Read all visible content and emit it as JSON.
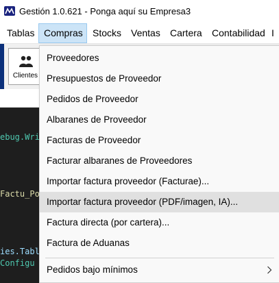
{
  "window": {
    "title": "Gestión 1.0.621 - Ponga aquí su Empresa3"
  },
  "menubar": {
    "items": [
      {
        "label": "Tablas"
      },
      {
        "label": "Compras"
      },
      {
        "label": "Stocks"
      },
      {
        "label": "Ventas"
      },
      {
        "label": "Cartera"
      },
      {
        "label": "Contabilidad"
      },
      {
        "label": "I"
      }
    ]
  },
  "toolbar": {
    "clientes_label": "Clientes"
  },
  "editor": {
    "lines": [
      {
        "text": "ebug.Wri",
        "color": "#4ec9b0"
      },
      {
        "text": "Factu_Po",
        "color": "#dcdcaa"
      },
      {
        "text": "ies.Tabl",
        "color": "#9cdcfe"
      },
      {
        "text": "Configu",
        "color": "#4ec9b0"
      }
    ]
  },
  "compras_menu": {
    "items": [
      {
        "label": "Proveedores"
      },
      {
        "label": "Presupuestos de Proveedor"
      },
      {
        "label": "Pedidos de Proveedor"
      },
      {
        "label": "Albaranes de Proveedor"
      },
      {
        "label": "Facturas de Proveedor"
      },
      {
        "label": "Facturar albaranes de Proveedores"
      },
      {
        "label": "Importar factura proveedor (Facturae)..."
      },
      {
        "label": "Importar factura proveedor (PDF/imagen, IA)..."
      },
      {
        "label": "Factura directa (por cartera)..."
      },
      {
        "label": "Factura de Aduanas"
      },
      {
        "label": "Pedidos bajo mínimos"
      }
    ]
  },
  "colors": {
    "menu_active_bg": "#cce4f7",
    "menu_item_highlight": "#e0e0e0",
    "editor_bg": "#1e1e1e"
  }
}
